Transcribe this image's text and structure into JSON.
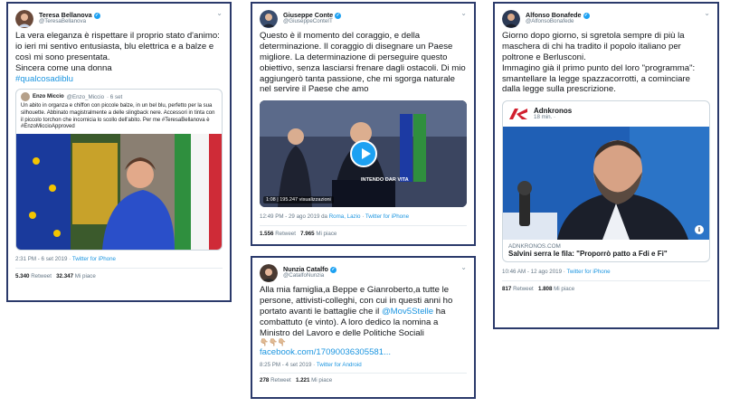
{
  "tweets": {
    "bellanova": {
      "name": "Teresa Bellanova",
      "handle": "@TeresaBellanova",
      "text": "La vera eleganza è rispettare il proprio stato d'animo: io ieri mi sentivo entusiasta, blu elettrica e a balze e così mi sono presentata.",
      "text2": "Sincera come una donna",
      "hashtag": "#qualcosadiblu",
      "quote": {
        "name": "Enzo Miccio",
        "handle": "@Enzo_Miccio",
        "time": "· 6 set",
        "text": "Un abito in organza e chiffon con piccole balze, in un bel blu, perfetto per la sua silhouette. Abbinato magistralmente a delle slingback nere. Accessori in tinta con il piccolo torchon che incornicia lo scollo dell'abito. Per me #TeresaBellanova è #EnzoMiccioApproved"
      },
      "meta_time": "2:31 PM - 6 set 2019 · ",
      "meta_src": "Twitter for iPhone",
      "retweets": "5.340",
      "retweet_label": "Retweet",
      "likes": "32.347",
      "likes_label": "Mi piace"
    },
    "conte": {
      "name": "Giuseppe Conte",
      "handle": "@GiuseppeConteIT",
      "text": "Questo è il momento del coraggio, e della determinazione. Il coraggio di disegnare un Paese migliore. La determinazione di perseguire questo obiettivo, senza lasciarsi frenare dagli ostacoli. Di mio aggiungerò tanta passione, che mi sgorga naturale nel servire il Paese che amo",
      "video_duration": "1:08",
      "video_views": "195.247 visualizzazioni",
      "video_caption": "INTENDO DAR VITA",
      "meta_time": "12:49 PM - 29 ago 2019 da ",
      "meta_place": "Roma, Lazio",
      "meta_sep": " · ",
      "meta_src": "Twitter for iPhone",
      "retweets": "1.556",
      "retweet_label": "Retweet",
      "likes": "7.965",
      "likes_label": "Mi piace"
    },
    "bonafede": {
      "name": "Alfonso Bonafede",
      "handle": "@AlfonsoBonafede",
      "text": "Giorno dopo giorno, si sgretola sempre di più la maschera di chi ha tradito il popolo italiano per poltrone e Berlusconi.",
      "text2": "Immagino già il primo punto del loro \"programma\": smantellare la legge spazzacorrotti, a cominciare dalla legge sulla prescrizione.",
      "card_source": "Adnkronos",
      "card_time": "18 min. ·",
      "card_domain": "ADNKRONOS.COM",
      "card_title": "Salvini serra le fila: \"Proporrò patto a Fdi e Fi\"",
      "meta_time": "10:46 AM - 12 ago 2019 · ",
      "meta_src": "Twitter for iPhone",
      "retweets": "817",
      "retweet_label": "Retweet",
      "likes": "1.808",
      "likes_label": "Mi piace"
    },
    "catalfo": {
      "name": "Nunzia Catalfo",
      "handle": "@CatalfoNunzia",
      "text": "Alla mia famiglia,a Beppe e Gianroberto,a tutte le persone, attivisti-colleghi, con cui in questi anni ho portato avanti le battaglie che il ",
      "mention": "@Mov5Stelle",
      "text2": " ha combattuto (e vinto). A loro dedico la nomina a Ministro del Lavoro e delle Politiche Sociali",
      "emoji": "👇🏼👇🏼👇🏼",
      "link": "facebook.com/17090036305581...",
      "meta_time": "8:25 PM - 4 set 2019 · ",
      "meta_src": "Twitter for Android",
      "retweets": "278",
      "retweet_label": "Retweet",
      "likes": "1.221",
      "likes_label": "Mi piace"
    }
  },
  "colors": {
    "border": "#2b3a6b",
    "link": "#1b95e0",
    "verified": "#1da1f2",
    "adnkronos_red": "#d1202f"
  },
  "icons": [
    "verified-icon",
    "chevron-down-icon",
    "play-icon",
    "info-icon",
    "adnkronos-logo-icon"
  ]
}
